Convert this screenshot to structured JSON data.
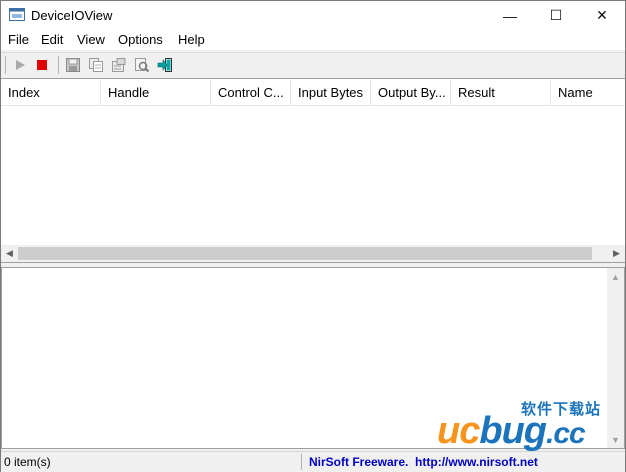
{
  "window": {
    "title": "DeviceIOView",
    "minimize_glyph": "—",
    "maximize_glyph": "☐",
    "close_glyph": "✕"
  },
  "menu": [
    {
      "label": "File"
    },
    {
      "label": "Edit"
    },
    {
      "label": "View"
    },
    {
      "label": "Options"
    },
    {
      "label": "Help"
    }
  ],
  "toolbar": {
    "icons": [
      "play-icon",
      "stop-icon",
      "save-icon",
      "copy-icon",
      "properties-icon",
      "find-icon",
      "exit-icon"
    ],
    "colors": {
      "stop": "#e00000",
      "play_disabled": "#a0a0a0",
      "exit": "#00a0a0"
    }
  },
  "listview": {
    "columns": [
      {
        "label": "Index"
      },
      {
        "label": "Handle"
      },
      {
        "label": "Control C..."
      },
      {
        "label": "Input Bytes"
      },
      {
        "label": "Output By..."
      },
      {
        "label": "Result"
      },
      {
        "label": "Name"
      }
    ]
  },
  "statusbar": {
    "item_count": "0 item(s)",
    "vendor": "NirSoft Freeware.",
    "url": "http://www.nirsoft.net"
  },
  "watermark": {
    "cn_text": "软件下载站",
    "logo_u": "u",
    "logo_c": "c",
    "logo_bug": "bug",
    "logo_cc": ".cc"
  }
}
